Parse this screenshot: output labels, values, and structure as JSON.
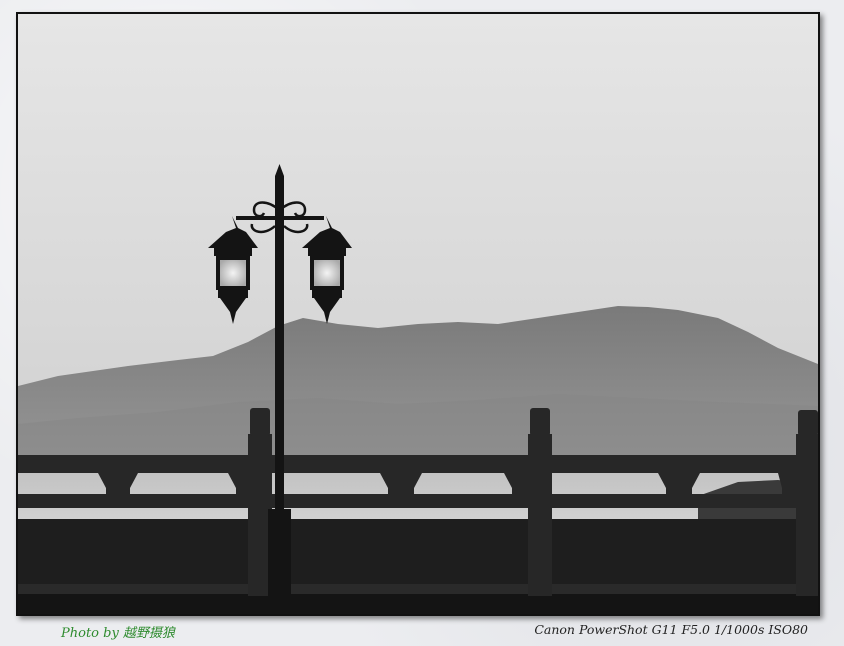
{
  "photo": {
    "subject": "street-lamp-silhouette"
  },
  "caption": {
    "credit": "Photo by 越野摄狼",
    "exif": "Canon PowerShot G11 F5.0 1/1000s ISO80"
  },
  "colors": {
    "credit_text": "#2e8b2e",
    "exif_text": "#222222",
    "border": "#111111"
  }
}
